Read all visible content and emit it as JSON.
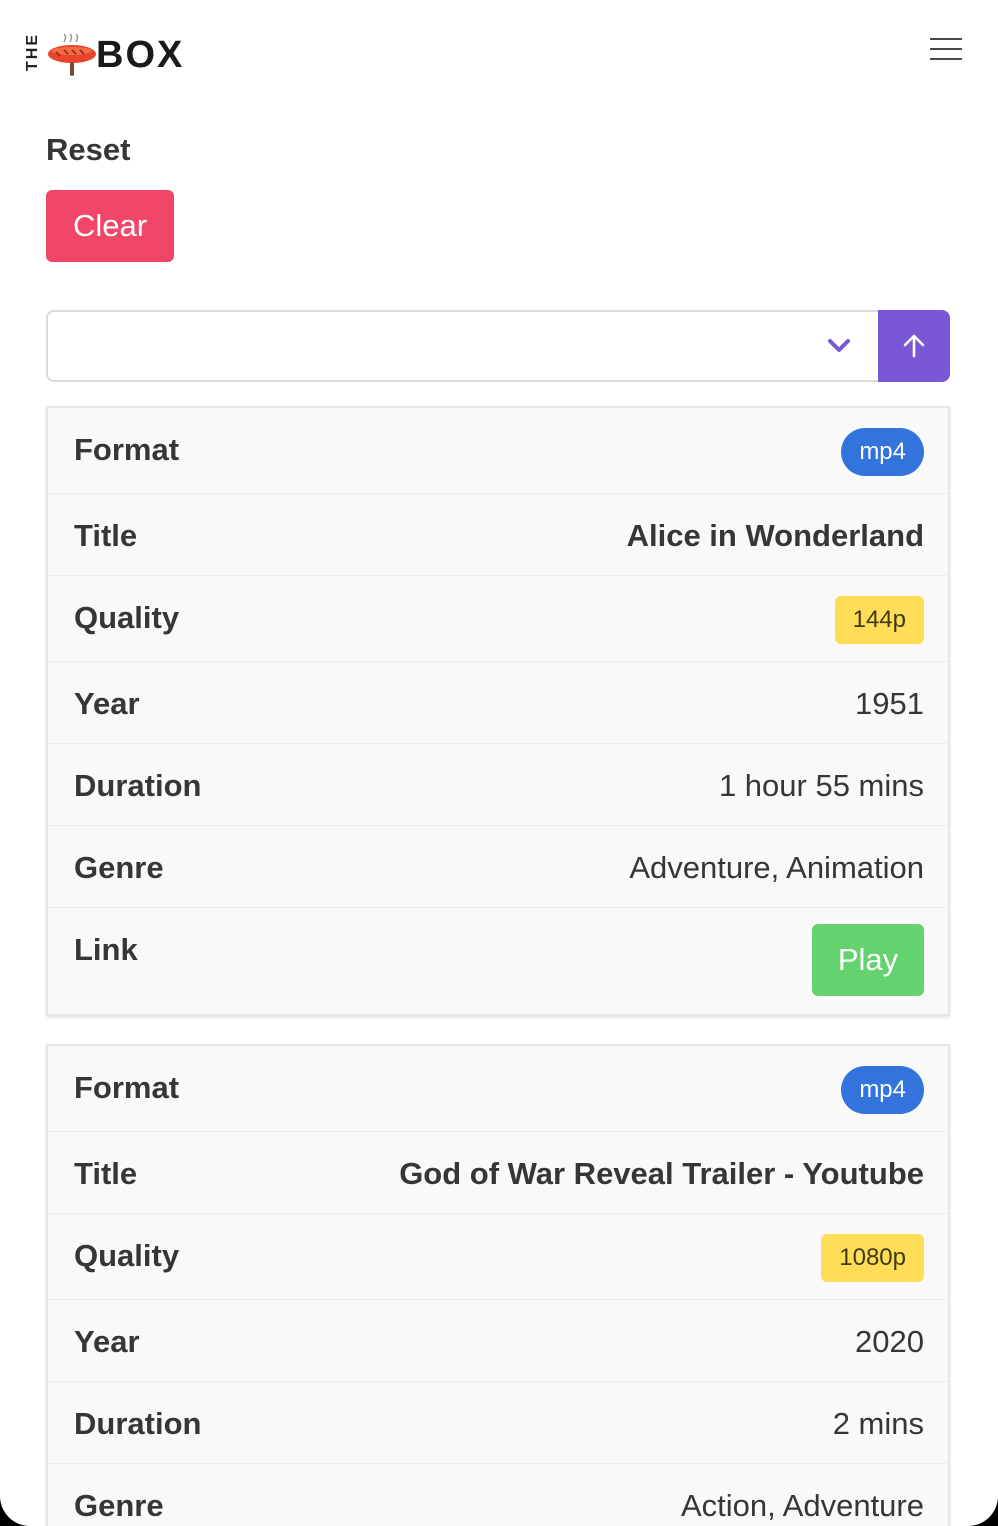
{
  "brand": {
    "logo_the": "THE",
    "logo_box": "BOX"
  },
  "colors": {
    "danger": "#f14668",
    "primary": "#7957d5",
    "info": "#3273dc",
    "warning": "#ffdd57",
    "success": "#64d26e"
  },
  "controls": {
    "reset_label": "Reset",
    "clear_button": "Clear",
    "sort_select_value": "",
    "sort_direction_icon": "arrow-up-icon"
  },
  "cards": [
    {
      "rows": {
        "format": {
          "label": "Format",
          "value": "mp4"
        },
        "title": {
          "label": "Title",
          "value": "Alice in Wonderland"
        },
        "quality": {
          "label": "Quality",
          "value": "144p"
        },
        "year": {
          "label": "Year",
          "value": "1951"
        },
        "duration": {
          "label": "Duration",
          "value": "1 hour 55 mins"
        },
        "genre": {
          "label": "Genre",
          "value": "Adventure, Animation"
        },
        "link": {
          "label": "Link",
          "value": "Play"
        }
      }
    },
    {
      "rows": {
        "format": {
          "label": "Format",
          "value": "mp4"
        },
        "title": {
          "label": "Title",
          "value": "God of War Reveal Trailer - Youtube"
        },
        "quality": {
          "label": "Quality",
          "value": "1080p"
        },
        "year": {
          "label": "Year",
          "value": "2020"
        },
        "duration": {
          "label": "Duration",
          "value": "2 mins"
        },
        "genre": {
          "label": "Genre",
          "value": "Action, Adventure"
        }
      }
    }
  ]
}
